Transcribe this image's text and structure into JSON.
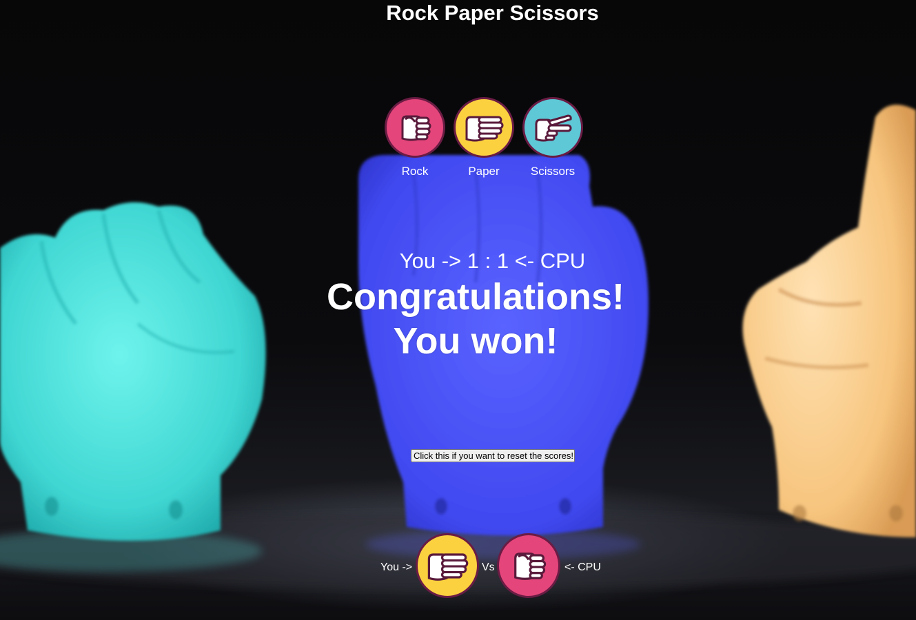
{
  "page": {
    "title": "Rock Paper Scissors"
  },
  "choices": [
    {
      "label": "Rock",
      "icon": "fist-hand-icon",
      "color": "#e4457a"
    },
    {
      "label": "Paper",
      "icon": "flat-hand-icon",
      "color": "#fbd13f"
    },
    {
      "label": "Scissors",
      "icon": "two-finger-hand-icon",
      "color": "#5ec8d6"
    }
  ],
  "scoreboard": {
    "text": "You -> 1 : 1 <- CPU",
    "you_score": 1,
    "cpu_score": 1
  },
  "result": {
    "line1": "Congratulations!",
    "line2": "You won!"
  },
  "reset": {
    "label": "Click this if you want to reset the scores!"
  },
  "match": {
    "you_label": "You ->",
    "vs_label": "Vs",
    "cpu_label": "<- CPU",
    "you_choice": "Paper",
    "cpu_choice": "Rock"
  },
  "colors": {
    "rock": "#e4457a",
    "paper": "#fbd13f",
    "scissors": "#5ec8d6",
    "outline": "#6a1c44"
  }
}
